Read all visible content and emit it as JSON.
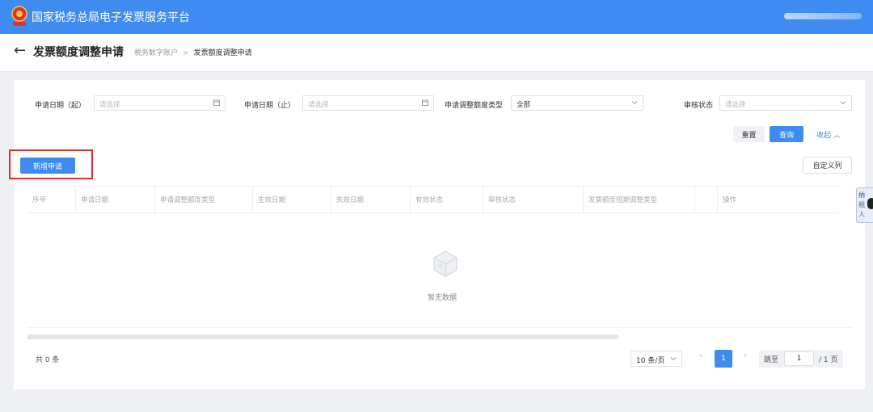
{
  "header": {
    "platform_title": "国家税务总局电子发票服务平台",
    "brand_color": "#3f8cf0"
  },
  "subheader": {
    "page_title": "发票额度调整申请",
    "breadcrumb": [
      "税务数字账户",
      "发票额度调整申请"
    ]
  },
  "filters": {
    "apply_date_start": {
      "label": "申请日期（起）",
      "placeholder": "请选择"
    },
    "apply_date_end": {
      "label": "申请日期（止）",
      "placeholder": "请选择"
    },
    "adjust_type": {
      "label": "申请调整额度类型",
      "value": "全部"
    },
    "review_status": {
      "label": "审核状态",
      "placeholder": "请选择"
    }
  },
  "actions": {
    "reset": "重置",
    "query": "查询",
    "collapse": "收起",
    "new_apply": "新增申请",
    "custom_columns": "自定义列"
  },
  "table": {
    "columns": [
      "序号",
      "申请日期",
      "申请调整额度类型",
      "生效日期",
      "失效日期",
      "有效状态",
      "审核状态",
      "发票额度短期调整类型",
      "",
      "操作"
    ],
    "empty_text": "暂无数据"
  },
  "pagination": {
    "total": "共 0 条",
    "page_size": "10 条/页",
    "current_page": "1",
    "jump_label": "跳至",
    "jump_value": "1",
    "total_pages": "/ 1 页"
  },
  "float_tab": {
    "label": "纳税人"
  }
}
